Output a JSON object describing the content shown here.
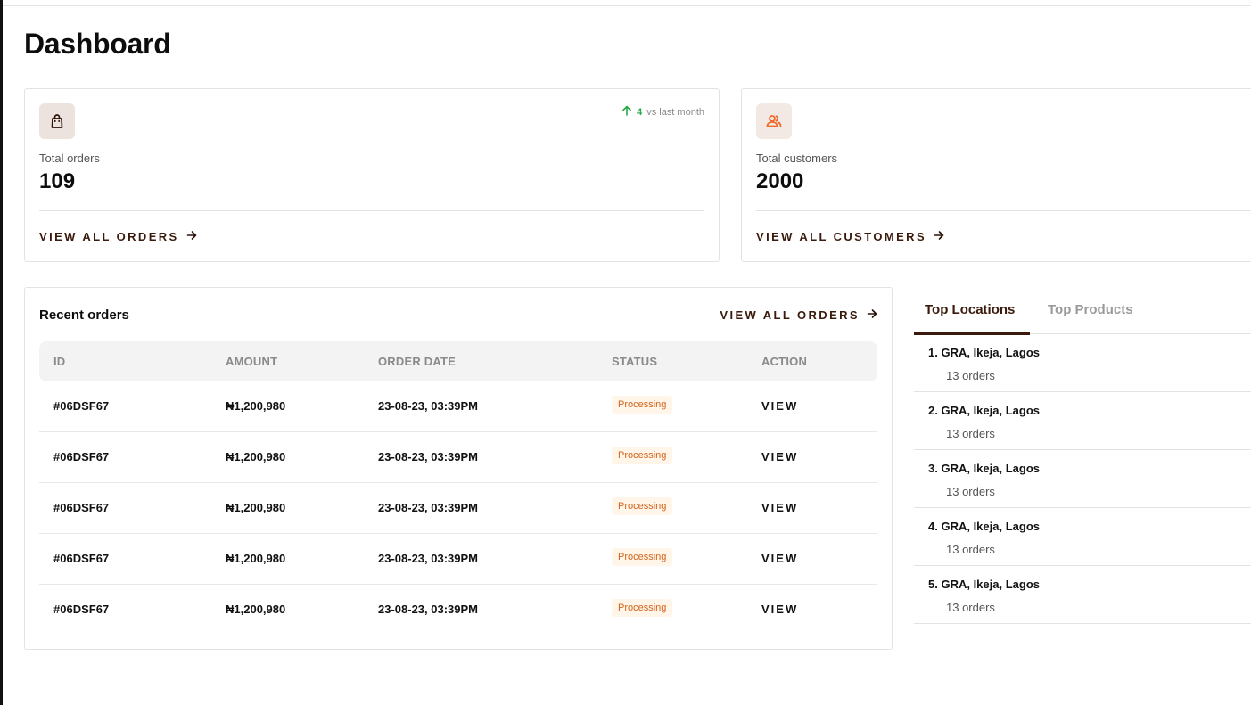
{
  "page": {
    "title": "Dashboard"
  },
  "stats": {
    "orders": {
      "label": "Total orders",
      "value": "109",
      "trend_value": "4",
      "trend_text": "vs last month",
      "link": "VIEW ALL ORDERS",
      "icon": "shopping-bag-icon"
    },
    "customers": {
      "label": "Total customers",
      "value": "2000",
      "link": "VIEW ALL CUSTOMERS",
      "icon": "users-icon"
    }
  },
  "recent_orders": {
    "title": "Recent orders",
    "link": "VIEW ALL ORDERS",
    "columns": [
      "ID",
      "AMOUNT",
      "ORDER DATE",
      "STATUS",
      "ACTION"
    ],
    "rows": [
      {
        "id": "#06DSF67",
        "amount": "₦1,200,980",
        "date": "23-08-23, 03:39PM",
        "status": "Processing",
        "action": "VIEW"
      },
      {
        "id": "#06DSF67",
        "amount": "₦1,200,980",
        "date": "23-08-23, 03:39PM",
        "status": "Processing",
        "action": "VIEW"
      },
      {
        "id": "#06DSF67",
        "amount": "₦1,200,980",
        "date": "23-08-23, 03:39PM",
        "status": "Processing",
        "action": "VIEW"
      },
      {
        "id": "#06DSF67",
        "amount": "₦1,200,980",
        "date": "23-08-23, 03:39PM",
        "status": "Processing",
        "action": "VIEW"
      },
      {
        "id": "#06DSF67",
        "amount": "₦1,200,980",
        "date": "23-08-23, 03:39PM",
        "status": "Processing",
        "action": "VIEW"
      }
    ]
  },
  "top": {
    "tabs": [
      "Top Locations",
      "Top Products"
    ],
    "active_tab": "Top Locations",
    "locations": [
      {
        "name": "1. GRA, Ikeja, Lagos",
        "count": "13 orders"
      },
      {
        "name": "2. GRA, Ikeja, Lagos",
        "count": "13 orders"
      },
      {
        "name": "3. GRA, Ikeja, Lagos",
        "count": "13 orders"
      },
      {
        "name": "4. GRA, Ikeja, Lagos",
        "count": "13 orders"
      },
      {
        "name": "5. GRA, Ikeja, Lagos",
        "count": "13 orders"
      }
    ]
  },
  "colors": {
    "brand_brown": "#3a1a0c",
    "trend_green": "#2aa84a",
    "status_orange": "#d4641c",
    "status_bg": "#fff5e8",
    "customer_icon": "#f06a2a"
  }
}
